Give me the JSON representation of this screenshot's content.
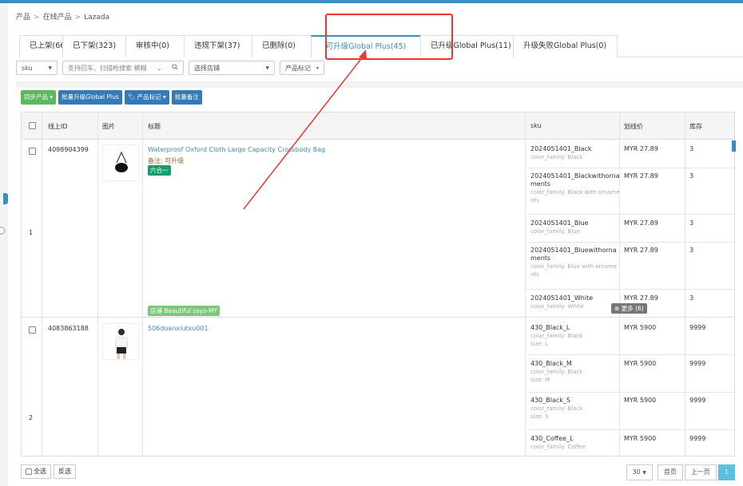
{
  "breadcrumb": [
    "产品",
    "在线产品",
    "Lazada"
  ],
  "tabs": [
    "已上架(66)",
    "已下架(323)",
    "审核中(0)",
    "违规下架(37)",
    "已删除(0)",
    "可升级Global Plus(45)",
    "已升级Global Plus(11)",
    "升级失败Global Plus(0)"
  ],
  "active_tab": 5,
  "filters": {
    "sku_select": "sku",
    "search_placeholder": "支持回车、扫描枪搜索  模糊",
    "store_select": "选择店铺",
    "tag_select": "产品标记"
  },
  "actions": {
    "sync": "同步产品",
    "upgrade": "批量升级Global Plus",
    "tag": "产品标记",
    "note": "批量备注"
  },
  "columns": {
    "id": "线上ID",
    "image": "图片",
    "title": "标题",
    "sku": "sku",
    "price": "划线价",
    "stock": "库存"
  },
  "products": [
    {
      "index": "1",
      "id": "4098904399",
      "title": "Waterproof Oxford Cloth Large Capacity Crossbody Bag",
      "note": "备注: 可升级",
      "tag": "六合一",
      "store_label": "店铺",
      "store_name": "Beautiful says-MY",
      "skus": [
        {
          "sku": "2024051401_Black",
          "attr": "color_family: Black",
          "price": "MYR 27.89",
          "stock": "3"
        },
        {
          "sku": "2024051401_Blackwithornaments",
          "attr": "color_family: Black with ornaments",
          "price": "MYR 27.89",
          "stock": "3"
        },
        {
          "sku": "2024051401_Blue",
          "attr": "color_family: Blue",
          "price": "MYR 27.89",
          "stock": "3"
        },
        {
          "sku": "2024051401_Bluewithornaments",
          "attr": "color_family: Blue with ornaments",
          "price": "MYR 27.89",
          "stock": "3"
        },
        {
          "sku": "2024051401_White",
          "attr": "color_family: White",
          "price": "MYR 27.89",
          "stock": "3"
        }
      ],
      "more": "更多 (6)"
    },
    {
      "index": "2",
      "id": "4083863188",
      "title": "506duanxiutxu001",
      "skus": [
        {
          "sku": "430_Black_L",
          "attr": "color_family: Black",
          "attr2": "size: L",
          "price": "MYR 5900",
          "stock": "9999"
        },
        {
          "sku": "430_Black_M",
          "attr": "color_family: Black",
          "attr2": "size: M",
          "price": "MYR 5900",
          "stock": "9999"
        },
        {
          "sku": "430_Black_S",
          "attr": "color_family: Black",
          "attr2": "size: S",
          "price": "MYR 5900",
          "stock": "9999"
        },
        {
          "sku": "430_Coffee_L",
          "attr": "color_family: Coffee",
          "price": "MYR 5900",
          "stock": "9999"
        }
      ]
    }
  ],
  "footer": {
    "select_all": "全选",
    "invert": "反选",
    "page_size": "30",
    "first": "首页",
    "prev": "上一页",
    "current_page": "1"
  },
  "colors": {
    "accent": "#3c8dbc",
    "highlight": "#e53935",
    "green": "#5cb85c",
    "tag_green": "#1a9c6e"
  }
}
